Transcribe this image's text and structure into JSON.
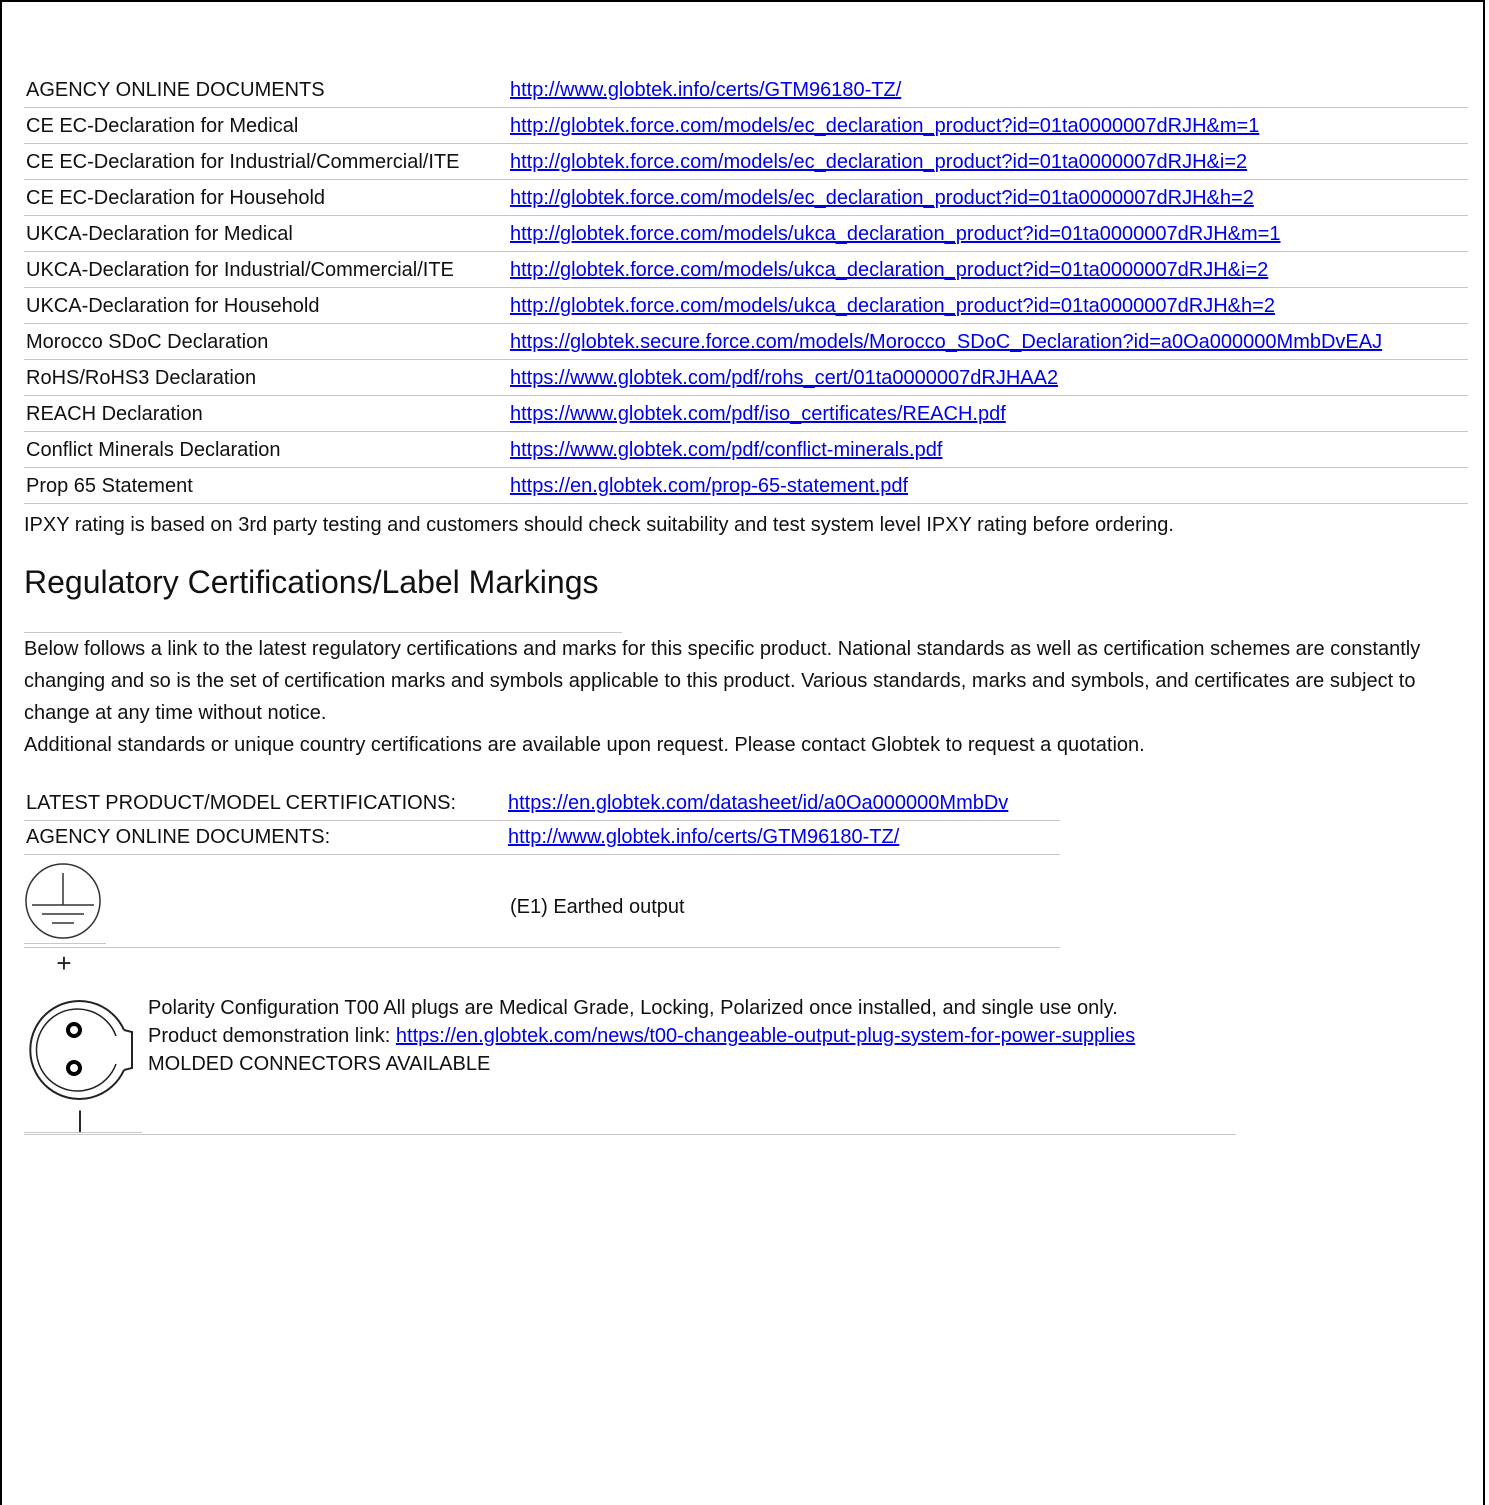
{
  "online_docs": [
    {
      "label": "AGENCY ONLINE DOCUMENTS",
      "url": "http://www.globtek.info/certs/GTM96180-TZ/"
    },
    {
      "label": "CE EC-Declaration for Medical",
      "url": "http://globtek.force.com/models/ec_declaration_product?id=01ta0000007dRJH&m=1"
    },
    {
      "label": "CE EC-Declaration for Industrial/Commercial/ITE",
      "url": "http://globtek.force.com/models/ec_declaration_product?id=01ta0000007dRJH&i=2"
    },
    {
      "label": "CE EC-Declaration for Household",
      "url": "http://globtek.force.com/models/ec_declaration_product?id=01ta0000007dRJH&h=2"
    },
    {
      "label": "UKCA-Declaration for Medical",
      "url": "http://globtek.force.com/models/ukca_declaration_product?id=01ta0000007dRJH&m=1"
    },
    {
      "label": "UKCA-Declaration for Industrial/Commercial/ITE",
      "url": "http://globtek.force.com/models/ukca_declaration_product?id=01ta0000007dRJH&i=2"
    },
    {
      "label": "UKCA-Declaration for Household",
      "url": "http://globtek.force.com/models/ukca_declaration_product?id=01ta0000007dRJH&h=2"
    },
    {
      "label": "Morocco SDoC Declaration",
      "url": "https://globtek.secure.force.com/models/Morocco_SDoC_Declaration?id=a0Oa000000MmbDvEAJ"
    },
    {
      "label": "RoHS/RoHS3 Declaration",
      "url": "https://www.globtek.com/pdf/rohs_cert/01ta0000007dRJHAA2"
    },
    {
      "label": "REACH Declaration",
      "url": "https://www.globtek.com/pdf/iso_certificates/REACH.pdf"
    },
    {
      "label": "Conflict Minerals Declaration",
      "url": "https://www.globtek.com/pdf/conflict-minerals.pdf"
    },
    {
      "label": "Prop 65 Statement",
      "url": "https://en.globtek.com/prop-65-statement.pdf"
    }
  ],
  "ipxy_note": "IPXY rating is based on 3rd party testing and customers should check suitability and test system level IPXY rating before ordering.",
  "section_title": "Regulatory Certifications/Label Markings",
  "paragraph_1": "Below follows a link to the latest regulatory certifications and marks for this specific product. National standards as well as certification schemes are constantly changing and so is the set of certification marks and symbols applicable to this product. Various standards, marks and symbols, and certificates are subject to change at any time without notice.",
  "paragraph_2": "Additional standards or unique country certifications are available upon request. Please contact Globtek to request a quotation.",
  "certs": [
    {
      "label": "LATEST PRODUCT/MODEL CERTIFICATIONS:",
      "url": "https://en.globtek.com/datasheet/id/a0Oa000000MmbDv"
    },
    {
      "label": "AGENCY ONLINE DOCUMENTS:",
      "url": "http://www.globtek.info/certs/GTM96180-TZ/"
    }
  ],
  "earthed": {
    "icon": "earth-ground-icon",
    "text": "(E1) Earthed output"
  },
  "polarity": {
    "icon": "polarity-connector-icon",
    "plus_symbol": "+",
    "minus_symbol": "|",
    "line1": "Polarity Configuration T00 All plugs are Medical Grade, Locking, Polarized once installed, and single use only.",
    "demo_label": "Product demonstration link: ",
    "demo_url": "https://en.globtek.com/news/t00-changeable-output-plug-system-for-power-supplies",
    "line3": "MOLDED CONNECTORS AVAILABLE"
  },
  "colors": {
    "link": "#0000ee",
    "rule": "#c8c8c8",
    "text": "#111111"
  }
}
